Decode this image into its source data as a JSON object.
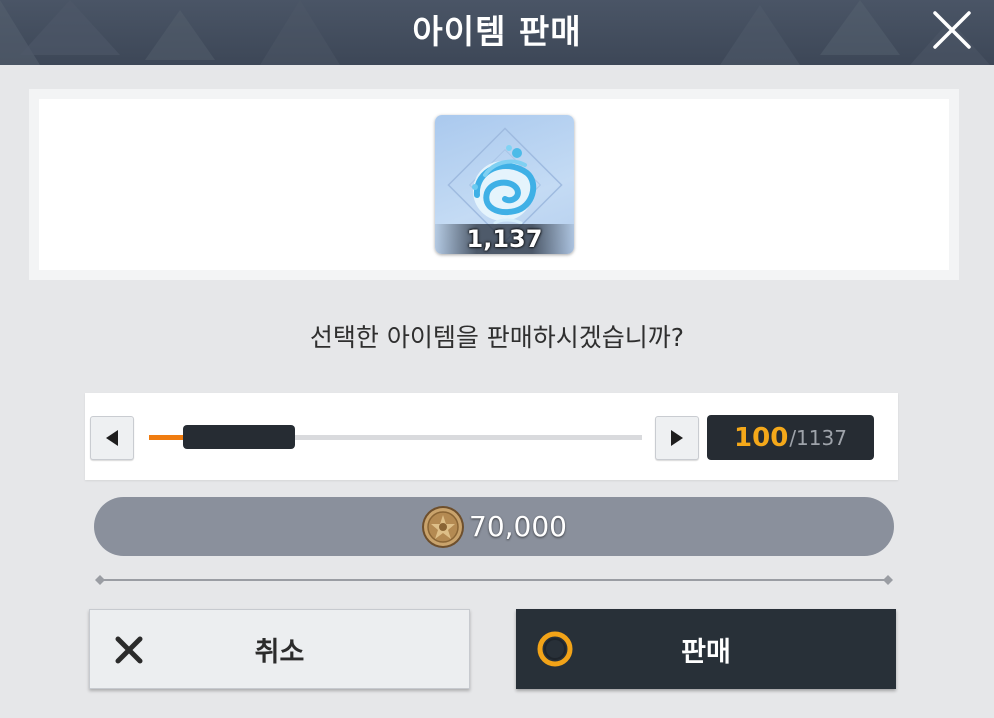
{
  "header": {
    "title": "아이템 판매",
    "close_icon": "close-icon"
  },
  "item": {
    "icon": "water-swirl-icon",
    "count": "1,137"
  },
  "question": "선택한 아이템을 판매하시겠습니까?",
  "quantity": {
    "current": "100",
    "total": "/1137",
    "fraction": 0.088
  },
  "price": {
    "icon": "coin-icon",
    "value": "70,000"
  },
  "buttons": {
    "cancel_label": "취소",
    "cancel_icon": "x-icon",
    "confirm_label": "판매",
    "confirm_icon": "circle-icon"
  },
  "colors": {
    "accent_orange": "#f07c10",
    "quantity_gold": "#f4a81a",
    "header_bg": "#434e5e",
    "confirm_bg": "#283038"
  }
}
